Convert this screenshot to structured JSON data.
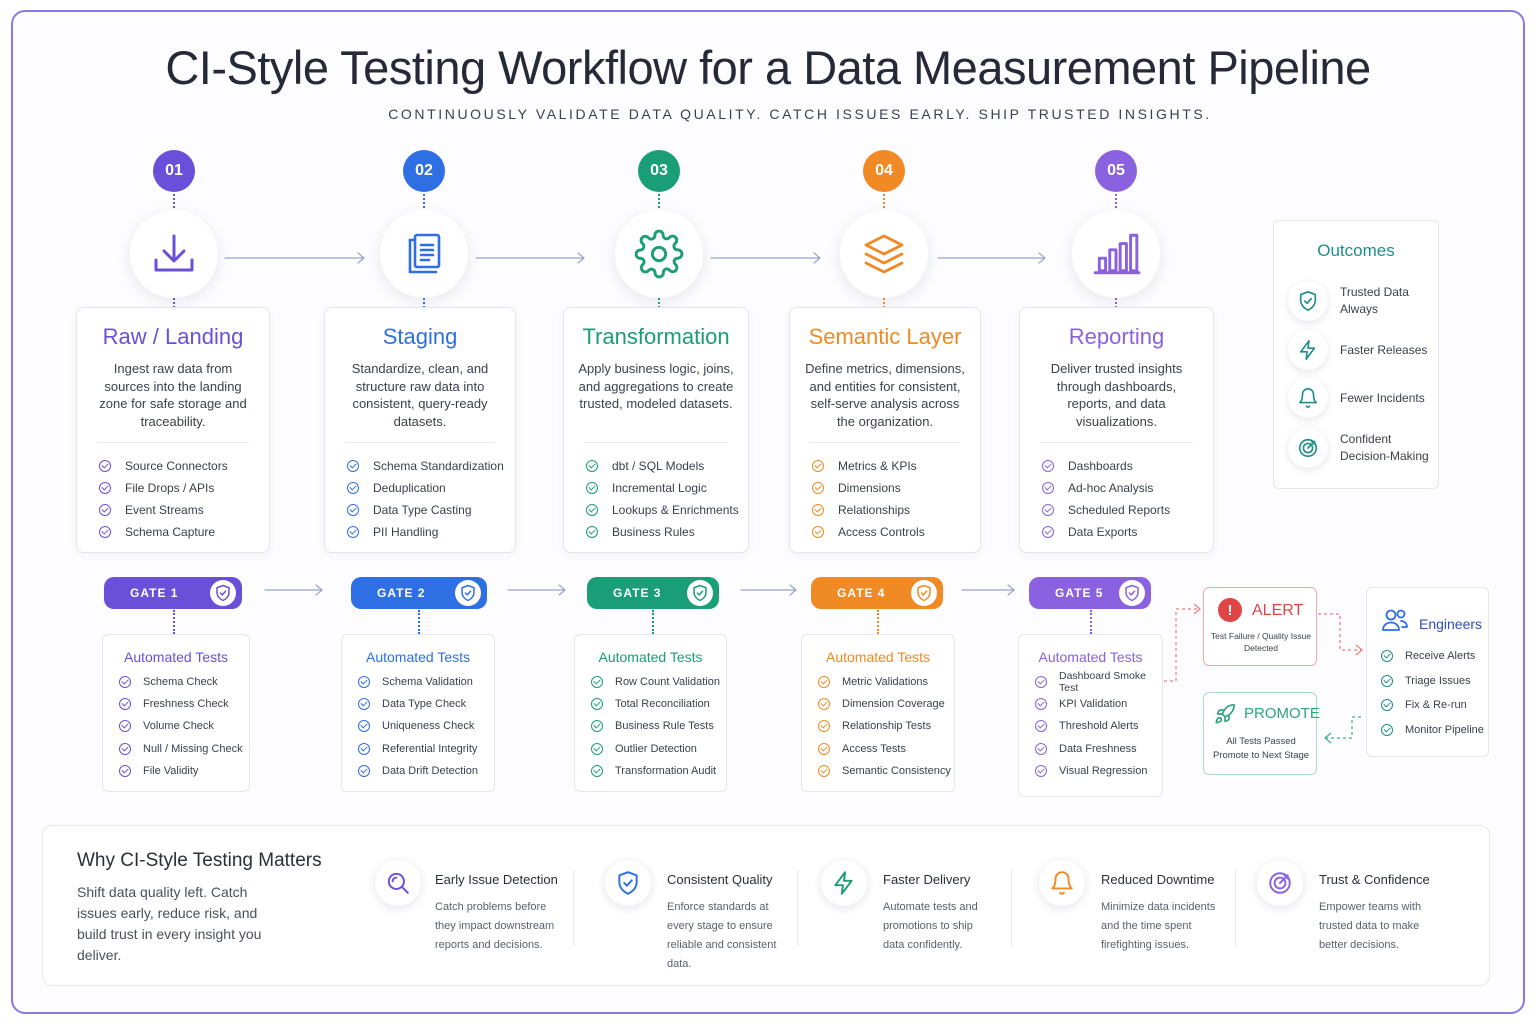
{
  "title": "CI-Style Testing Workflow for a Data Measurement Pipeline",
  "subtitle": "CONTINUOUSLY VALIDATE DATA QUALITY. CATCH ISSUES EARLY. SHIP TRUSTED INSIGHTS.",
  "colors": {
    "purple": "#6a4fd8",
    "blue": "#2f6fe4",
    "green": "#1a9e78",
    "orange": "#f08a24",
    "violet": "#8a62e0",
    "teal": "#1f8f88",
    "red": "#e04545",
    "mint": "#2fa37a"
  },
  "stages": [
    {
      "number": "01",
      "title": "Raw / Landing",
      "icon": "download-icon",
      "description": "Ingest raw data from sources into the landing zone for safe storage and traceability.",
      "items": [
        "Source Connectors",
        "File Drops / APIs",
        "Event Streams",
        "Schema Capture"
      ],
      "gate": "GATE 1",
      "tests_title": "Automated Tests",
      "tests": [
        "Schema Check",
        "Freshness Check",
        "Volume Check",
        "Null / Missing Check",
        "File Validity"
      ]
    },
    {
      "number": "02",
      "title": "Staging",
      "icon": "document-icon",
      "description": "Standardize, clean, and structure raw data into consistent, query-ready datasets.",
      "items": [
        "Schema Standardization",
        "Deduplication",
        "Data Type Casting",
        "PII Handling"
      ],
      "gate": "GATE 2",
      "tests_title": "Automated Tests",
      "tests": [
        "Schema Validation",
        "Data Type Check",
        "Uniqueness Check",
        "Referential Integrity",
        "Data Drift Detection"
      ]
    },
    {
      "number": "03",
      "title": "Transformation",
      "icon": "gear-icon",
      "description": "Apply business logic, joins, and aggregations to create trusted, modeled datasets.",
      "items": [
        "dbt / SQL Models",
        "Incremental Logic",
        "Lookups & Enrichments",
        "Business Rules"
      ],
      "gate": "GATE 3",
      "tests_title": "Automated Tests",
      "tests": [
        "Row Count Validation",
        "Total Reconciliation",
        "Business Rule Tests",
        "Outlier Detection",
        "Transformation Audit"
      ]
    },
    {
      "number": "04",
      "title": "Semantic Layer",
      "icon": "layers-icon",
      "description": "Define metrics, dimensions, and entities for consistent, self-serve analysis across the organization.",
      "items": [
        "Metrics & KPIs",
        "Dimensions",
        "Relationships",
        "Access Controls"
      ],
      "gate": "GATE 4",
      "tests_title": "Automated Tests",
      "tests": [
        "Metric Validations",
        "Dimension Coverage",
        "Relationship Tests",
        "Access Tests",
        "Semantic Consistency"
      ]
    },
    {
      "number": "05",
      "title": "Reporting",
      "icon": "bar-chart-icon",
      "description": "Deliver trusted insights through dashboards, reports, and data visualizations.",
      "items": [
        "Dashboards",
        "Ad-hoc Analysis",
        "Scheduled Reports",
        "Data Exports"
      ],
      "gate": "GATE 5",
      "tests_title": "Automated Tests",
      "tests": [
        "Dashboard Smoke Test",
        "KPI Validation",
        "Threshold Alerts",
        "Data Freshness",
        "Visual Regression"
      ]
    }
  ],
  "outcomes": {
    "title": "Outcomes",
    "items": [
      {
        "label": "Trusted Data Always",
        "icon": "shield-check-icon"
      },
      {
        "label": "Faster Releases",
        "icon": "lightning-icon"
      },
      {
        "label": "Fewer Incidents",
        "icon": "bell-icon"
      },
      {
        "label": "Confident Decision-Making",
        "icon": "target-icon"
      }
    ]
  },
  "alert": {
    "title": "ALERT",
    "text": "Test Failure / Quality Issue Detected"
  },
  "promote": {
    "title": "PROMOTE",
    "text": "All Tests Passed Promote to Next Stage"
  },
  "engineers": {
    "title": "Engineers",
    "items": [
      "Receive Alerts",
      "Triage Issues",
      "Fix & Re-run",
      "Monitor Pipeline"
    ]
  },
  "why": {
    "title": "Why CI-Style Testing Matters",
    "lead": "Shift data quality left. Catch issues early, reduce risk, and build trust in every insight you deliver.",
    "benefits": [
      {
        "title": "Early Issue Detection",
        "text": "Catch problems before they impact downstream reports and decisions.",
        "icon": "magnifier-icon"
      },
      {
        "title": "Consistent Quality",
        "text": "Enforce standards at every stage to ensure reliable and consistent data.",
        "icon": "shield-check-icon"
      },
      {
        "title": "Faster Delivery",
        "text": "Automate tests and promotions to ship data confidently.",
        "icon": "lightning-icon"
      },
      {
        "title": "Reduced Downtime",
        "text": "Minimize data incidents and the time spent firefighting issues.",
        "icon": "bell-icon"
      },
      {
        "title": "Trust & Confidence",
        "text": "Empower teams with trusted data to make better decisions.",
        "icon": "target-icon"
      }
    ]
  }
}
